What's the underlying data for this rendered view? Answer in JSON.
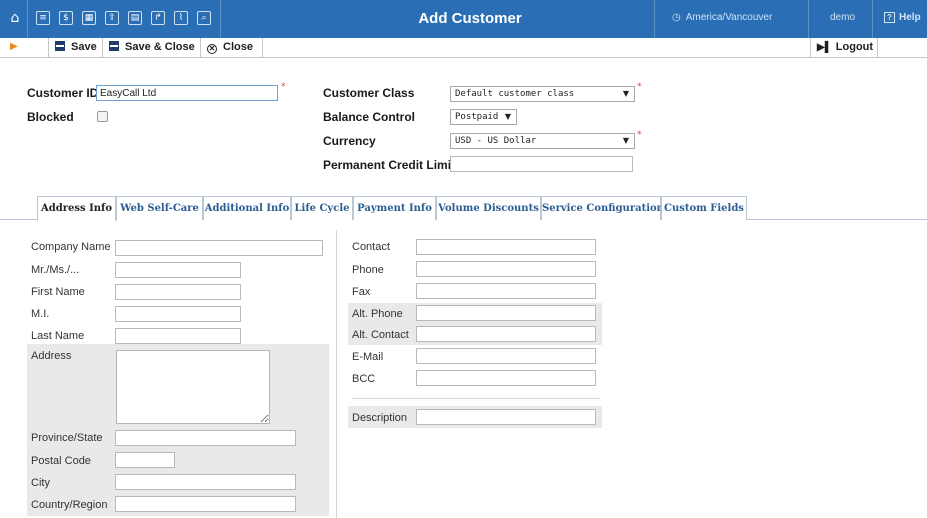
{
  "topbar": {
    "title": "Add Customer",
    "timezone": "America/Vancouver",
    "timezone_icon": "clock-icon",
    "user": "demo",
    "help": "Help",
    "nav_icons": [
      "home-icon",
      "list-icon",
      "dollar-icon",
      "grid-icon",
      "upload-icon",
      "config-icon",
      "transfer-icon",
      "chart-icon",
      "search-icon"
    ]
  },
  "toolbar": {
    "save": "Save",
    "save_close": "Save & Close",
    "close": "Close",
    "logout": "Logout"
  },
  "header_form": {
    "customer_id_label": "Customer ID",
    "customer_id_value": "EasyCall Ltd",
    "blocked_label": "Blocked",
    "customer_class_label": "Customer Class",
    "customer_class_value": "Default customer class",
    "balance_control_label": "Balance Control",
    "balance_control_value": "Postpaid",
    "currency_label": "Currency",
    "currency_value": "USD - US Dollar",
    "credit_limit_label": "Permanent Credit Limit",
    "required_mark": "*"
  },
  "tabs": [
    {
      "label": "Address Info",
      "active": true
    },
    {
      "label": "Web Self-Care",
      "active": false
    },
    {
      "label": "Additional Info",
      "active": false
    },
    {
      "label": "Life Cycle",
      "active": false
    },
    {
      "label": "Payment Info",
      "active": false
    },
    {
      "label": "Volume Discounts",
      "active": false
    },
    {
      "label": "Service Configuration",
      "active": false
    },
    {
      "label": "Custom Fields",
      "active": false
    }
  ],
  "address_left": {
    "company_name": "Company Name",
    "salutation": "Mr./Ms./...",
    "first_name": "First Name",
    "mi": "M.I.",
    "last_name": "Last Name",
    "address": "Address",
    "province": "Province/State",
    "postal_code": "Postal Code",
    "city": "City",
    "country": "Country/Region"
  },
  "address_right": {
    "contact": "Contact",
    "phone": "Phone",
    "fax": "Fax",
    "alt_phone": "Alt. Phone",
    "alt_contact": "Alt. Contact",
    "email": "E-Mail",
    "bcc": "BCC",
    "description": "Description"
  },
  "colors": {
    "topbar_bg": "#2a6fb5",
    "tab_link": "#2b5d93",
    "required": "#e04040",
    "toolbar_arrow": "#e98a1d"
  }
}
